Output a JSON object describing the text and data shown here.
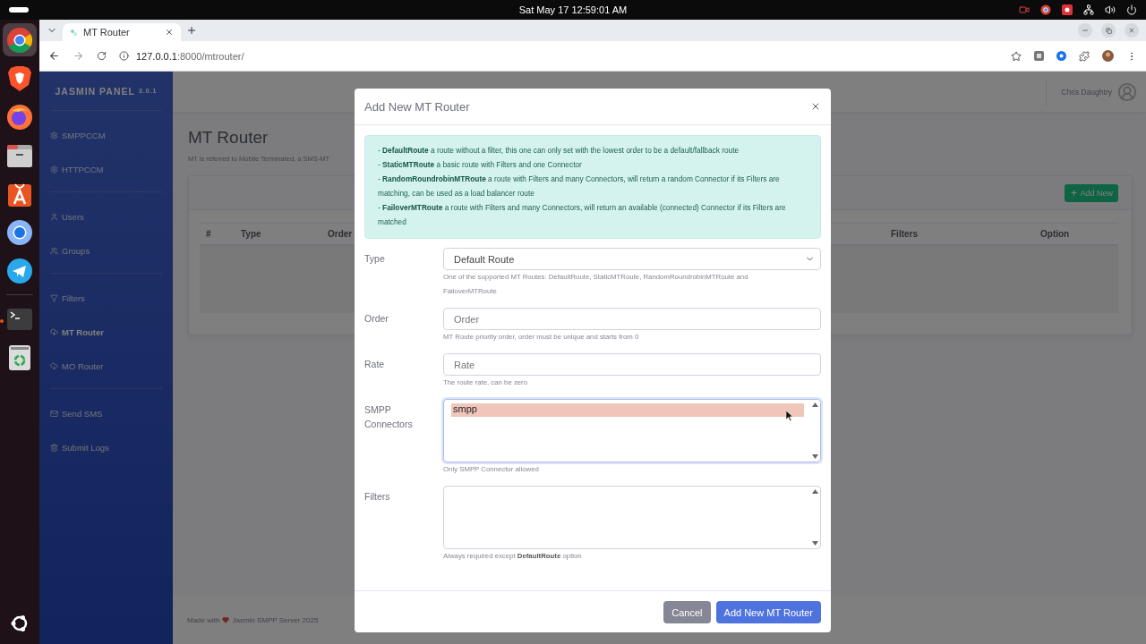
{
  "system_bar": {
    "clock": "Sat May 17  12:59:01 AM"
  },
  "dock": {
    "groups": [
      [
        {
          "kind": "chrome",
          "selected": true,
          "running": false
        },
        {
          "kind": "brave",
          "selected": false,
          "running": false
        },
        {
          "kind": "firefox",
          "selected": false,
          "running": false
        },
        {
          "kind": "files",
          "selected": false,
          "running": false
        },
        {
          "kind": "appcenter",
          "selected": false,
          "running": false
        },
        {
          "kind": "chromium",
          "selected": false,
          "running": false
        },
        {
          "kind": "telegram",
          "selected": false,
          "running": false
        }
      ],
      [
        {
          "kind": "terminal",
          "selected": false,
          "running": true
        },
        {
          "kind": "trash",
          "selected": false,
          "running": false
        }
      ]
    ]
  },
  "browser": {
    "tab_title": "MT Router",
    "address": {
      "host": "127.0.0.1",
      "path": ":8000/mtrouter/"
    }
  },
  "sidebar": {
    "brand": "JASMIN PANEL",
    "version": "3.0.1",
    "groups": [
      [
        {
          "kind": "gear",
          "label": "SMPPCCM",
          "selected": false
        },
        {
          "kind": "gear",
          "label": "HTTPCCM",
          "selected": false
        }
      ],
      [
        {
          "kind": "user",
          "label": "Users",
          "selected": false
        },
        {
          "kind": "users",
          "label": "Groups",
          "selected": false
        }
      ],
      [
        {
          "kind": "filter",
          "label": "Filters",
          "selected": false
        },
        {
          "kind": "upload",
          "label": "MT Router",
          "selected": true
        },
        {
          "kind": "download",
          "label": "MO Router",
          "selected": false
        }
      ],
      [
        {
          "kind": "mail",
          "label": "Send SMS",
          "selected": false
        },
        {
          "kind": "trash",
          "label": "Submit Logs",
          "selected": false
        }
      ]
    ]
  },
  "topbar": {
    "user": "Chris Daughtry"
  },
  "page": {
    "title": "MT Router",
    "subtitle": "MT is referred to Mobile Terminated, a SMS-MT",
    "add_button": "Add New",
    "columns": [
      "#",
      "Type",
      "Order",
      "Filters",
      "Option"
    ]
  },
  "footer": {
    "before": "Made with",
    "after": "Jasmin SMPP Server 2025"
  },
  "modal": {
    "title": "Add New MT Router",
    "info": [
      "- **DefaultRoute** a route without a filter, this one can only set with the lowest order to be a default/fallback route",
      "- **StaticMTRoute** a basic route with Filters and one Connector",
      "- **RandomRoundrobinMTRoute** a route with Filters and many Connectors, will return a random Connector if its Filters are matching, can be used as a load balancer route",
      "- **FailoverMTRoute** a route with Filters and many Connectors, will return an available (connected) Connector if its Filters are matched"
    ],
    "fields": [
      {
        "kind": "select",
        "label": "Type",
        "value": "Default Route",
        "help": "One of the supported MT Routes: DefaultRoute, StaticMTRoute, RandomRoundrobinMTRoute and FailoverMTRoute"
      },
      {
        "kind": "input",
        "label": "Order",
        "placeholder": "Order",
        "help": "MT Route priority order, order must be unique and starts from 0"
      },
      {
        "kind": "input",
        "label": "Rate",
        "placeholder": "Rate",
        "help": "The route rate, can be zero"
      },
      {
        "kind": "multiselect",
        "label": "SMPP Connectors",
        "focused": true,
        "options": [
          {
            "label": "smpp",
            "selected": true
          }
        ],
        "help": "Only SMPP Connector allowed"
      },
      {
        "kind": "multiselect",
        "label": "Filters",
        "focused": false,
        "help": "Always required except **DefaultRoute** option"
      }
    ],
    "buttons": [
      {
        "kind": "secondary",
        "label": "Cancel"
      },
      {
        "kind": "primary",
        "label": "Add New MT Router"
      }
    ]
  }
}
